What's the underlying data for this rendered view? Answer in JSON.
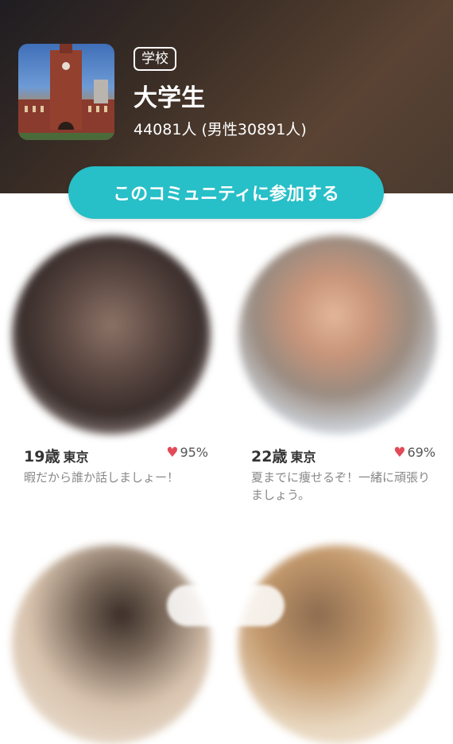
{
  "community": {
    "tag": "学校",
    "title": "大学生",
    "members": "44081人 (男性30891人)",
    "join_label": "このコミュニティに参加する"
  },
  "users": [
    {
      "age": "19歳",
      "place": "東京",
      "match": "95%",
      "message": "暇だから誰か話しましょー！"
    },
    {
      "age": "22歳",
      "place": "東京",
      "match": "69%",
      "message": "夏までに痩せるぞ！一緒に頑張りましょう。"
    }
  ],
  "colors": {
    "accent": "#27bfc8",
    "heart": "#e24a57"
  },
  "icons": {
    "match": "heart-icon"
  }
}
